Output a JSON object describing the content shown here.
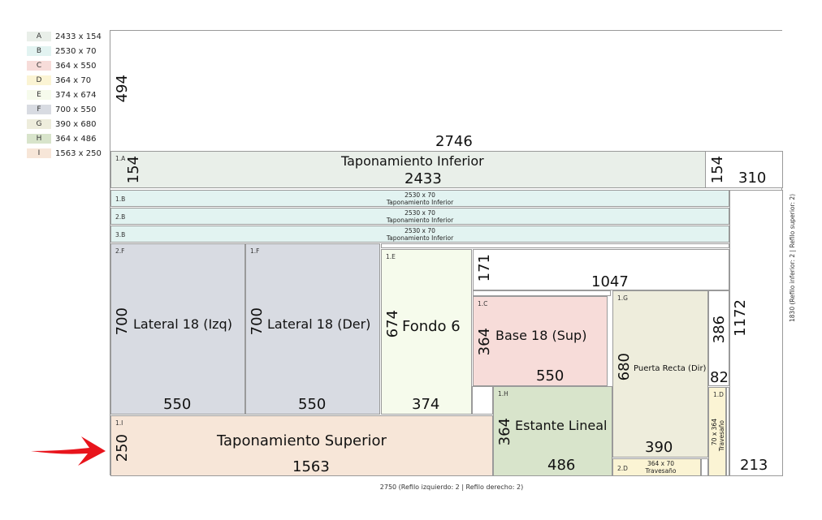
{
  "legend": [
    {
      "code": "A",
      "size": "2433 x 154",
      "color": "#e9efe9"
    },
    {
      "code": "B",
      "size": "2530 x 70",
      "color": "#e2f3f1"
    },
    {
      "code": "C",
      "size": "364 x 550",
      "color": "#f7dcd9"
    },
    {
      "code": "D",
      "size": "364 x 70",
      "color": "#fbf4d4"
    },
    {
      "code": "E",
      "size": "374 x 674",
      "color": "#f6fbec"
    },
    {
      "code": "F",
      "size": "700 x 550",
      "color": "#d8dbe2"
    },
    {
      "code": "G",
      "size": "390 x 680",
      "color": "#eeeddc"
    },
    {
      "code": "H",
      "size": "364 x 486",
      "color": "#d8e4cb"
    },
    {
      "code": "I",
      "size": "1563 x 250",
      "color": "#f7e6d8"
    }
  ],
  "board": {
    "top_waste": {
      "h": "494",
      "w": "2746"
    },
    "piece_1A": {
      "id": "1.A",
      "h": "154",
      "label": "Taponamiento Inferior",
      "w": "2433"
    },
    "waste_right_A": {
      "h": "154",
      "w": "310"
    },
    "strips": [
      {
        "id": "1.B",
        "size": "2530 x 70",
        "label": "Taponamiento Inferior"
      },
      {
        "id": "2.B",
        "size": "2530 x 70",
        "label": "Taponamiento Inferior"
      },
      {
        "id": "3.B",
        "size": "2530 x 70",
        "label": "Taponamiento Inferior"
      }
    ],
    "piece_2F": {
      "id": "2.F",
      "h": "700",
      "label": "Lateral 18 (Izq)",
      "w": "550"
    },
    "piece_1F": {
      "id": "1.F",
      "h": "700",
      "label": "Lateral 18 (Der)",
      "w": "550"
    },
    "piece_1E": {
      "id": "1.E",
      "h": "674",
      "label": "Fondo 6",
      "w": "374"
    },
    "waste_mid": {
      "h": "171",
      "w": "1047"
    },
    "piece_1C": {
      "id": "1.C",
      "h": "364",
      "label": "Base 18  (Sup)",
      "w": "550"
    },
    "piece_1G": {
      "id": "1.G",
      "h": "680",
      "label": "Puerta Recta (Dir)",
      "w": "390"
    },
    "waste_small": {
      "h": "386",
      "w": "82"
    },
    "waste_right_col": {
      "h": "1172",
      "w": "213"
    },
    "piece_1H": {
      "id": "1.H",
      "h": "364",
      "label": "Estante Lineal",
      "w": "486"
    },
    "piece_1I": {
      "id": "1.I",
      "h": "250",
      "label": "Taponamiento Superior",
      "w": "1563"
    },
    "piece_2D": {
      "id": "2.D",
      "size": "364 x 70",
      "label": "Travesaño"
    },
    "piece_1D": {
      "id": "1.D",
      "size": "70 x 364",
      "label": "Travesaño"
    }
  },
  "side_label": "1830 (Refilo inferior: 2 | Refilo superior: 2)",
  "bottom_label": "2750 (Refilo izquierdo: 2  | Refilo derecho: 2)",
  "arrow_color": "#e8141c"
}
